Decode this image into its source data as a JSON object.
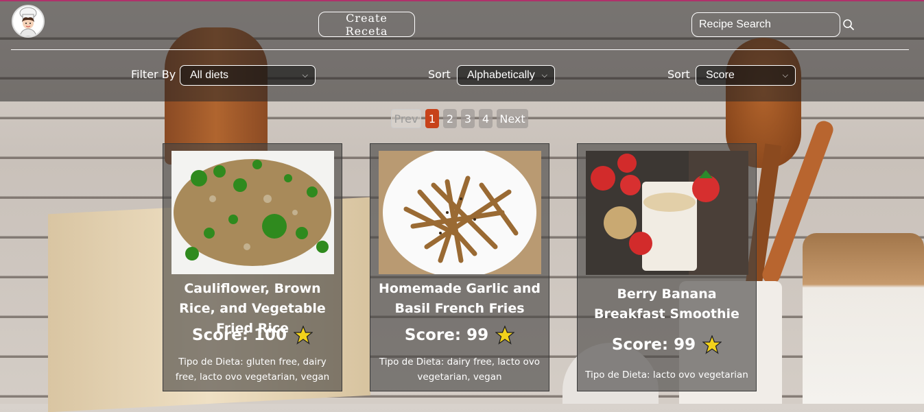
{
  "header": {
    "create_label": "Create Receta",
    "search_placeholder": "Recipe Search",
    "search_icon": "search-icon",
    "logo_icon": "chef-logo"
  },
  "controls": {
    "filter_label": "Filter By",
    "filter_value": "All diets",
    "sort1_label": "Sort",
    "sort1_value": "Alphabetically",
    "sort2_label": "Sort",
    "sort2_value": "Score"
  },
  "pagination": {
    "prev": "Prev",
    "pages": [
      "1",
      "2",
      "3",
      "4"
    ],
    "current": "1",
    "next": "Next",
    "active_color": "#c7421a"
  },
  "recipes": [
    {
      "title": "Cauliflower, Brown Rice, and Vegetable Fried Rice",
      "score": "Score: 100",
      "diet": "Tipo de Dieta: gluten free, dairy free, lacto ovo vegetarian, vegan"
    },
    {
      "title": "Homemade Garlic and Basil French Fries",
      "score": "Score: 99",
      "diet": "Tipo de Dieta: dairy free, lacto ovo vegetarian, vegan"
    },
    {
      "title": "Berry Banana Breakfast Smoothie",
      "score": "Score: 99",
      "diet": "Tipo de Dieta: lacto ovo vegetarian"
    }
  ],
  "colors": {
    "star": "#f2d21b",
    "topbar_accent": "#b0306a"
  }
}
